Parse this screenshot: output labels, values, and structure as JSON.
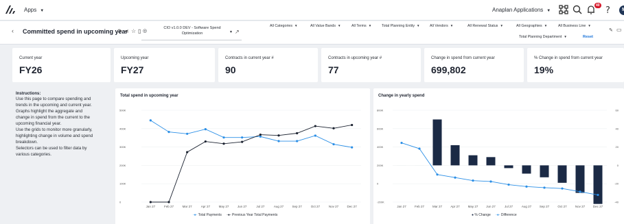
{
  "topbar": {
    "apps_label": "Apps",
    "app_name": "Anaplan Applications",
    "notification_count": "40",
    "avatar_initials": "M"
  },
  "header": {
    "title": "Committed spend in upcoming year",
    "version_label": "CIO v1.0.0 DEV - Software Spend Optimization",
    "filters": [
      "All Categories",
      "All Value Bands",
      "All Terms",
      "Total Planning Entity",
      "All Vendors",
      "All Renewal Status",
      "All Geographies",
      "All Business Line",
      "Total Planning Department"
    ],
    "reset_label": "Reset"
  },
  "kpis": [
    {
      "label": "Current year",
      "value": "FY26"
    },
    {
      "label": "Upcoming year",
      "value": "FY27"
    },
    {
      "label": "Contracts in current year #",
      "value": "90"
    },
    {
      "label": "Contracts in upcoming year #",
      "value": "77"
    },
    {
      "label": "Change in spend from current year",
      "value": "699,802"
    },
    {
      "label": "% Change in spend from current year",
      "value": "19%"
    }
  ],
  "instructions": {
    "title": "Instructions:",
    "lines": [
      "Use this page to compare spending and",
      "trends in the upcoming and current year.",
      "Graphs highlight the aggregate and",
      "change in spend from the current to the",
      "upcoming financial year.",
      "Use the grids to monitor more granularly,",
      "highlighting change in volume and spend",
      "breakdown.",
      "Selectors can be used to filter data by",
      "various categories."
    ]
  },
  "colors": {
    "blue": "#2b8fe6",
    "dark": "#1b2230",
    "navy": "#1b2a45",
    "accent_link": "#1a73d9",
    "badge_red": "#d6182a"
  },
  "chart_data": [
    {
      "type": "line",
      "title": "Total spend in upcoming year",
      "categories": [
        "Jan 27",
        "Feb 27",
        "Mar 27",
        "Apr 27",
        "May 27",
        "Jun 27",
        "Jul 27",
        "Aug 27",
        "Sep 27",
        "Oct 27",
        "Nov 27",
        "Dec 27"
      ],
      "yticks": [
        "0",
        "100K",
        "200K",
        "300K",
        "400K",
        "500K"
      ],
      "ylim": [
        0,
        500000
      ],
      "series": [
        {
          "name": "Total Payments",
          "color": "#2b8fe6",
          "values": [
            445000,
            382000,
            372000,
            397000,
            352000,
            352000,
            357000,
            332000,
            332000,
            362000,
            315000,
            298000
          ]
        },
        {
          "name": "Previous Year Total Payments",
          "color": "#1b2230",
          "values": [
            0,
            0,
            272000,
            330000,
            318000,
            328000,
            367000,
            363000,
            375000,
            414000,
            402000,
            420000
          ]
        }
      ],
      "legend": "bottom"
    },
    {
      "type": "bar+line",
      "title": "Change in yearly spend",
      "categories": [
        "Jan 27",
        "Feb 27",
        "Mar 27",
        "Apr 27",
        "May 27",
        "Jun 27",
        "Jul 27",
        "Aug 27",
        "Sep 27",
        "Oct 27",
        "Nov 27",
        "Dec 27"
      ],
      "left_yticks": [
        "-200K",
        "0",
        "200K",
        "400K",
        "600K",
        "800K"
      ],
      "left_ylim": [
        -200000,
        800000
      ],
      "right_yticks": [
        "-40",
        "-20",
        "0",
        "20",
        "40",
        "60"
      ],
      "right_ylim": [
        -40,
        60
      ],
      "series": [
        {
          "name": "% Change",
          "type": "bar",
          "axis": "right",
          "color": "#1b2a45",
          "values": [
            0,
            0,
            50,
            22,
            11,
            9,
            -3,
            -9,
            -13,
            -19,
            -30,
            -42
          ]
        },
        {
          "name": "Difference",
          "type": "line",
          "axis": "left",
          "color": "#2b8fe6",
          "values": [
            445000,
            382000,
            100000,
            67000,
            34000,
            24000,
            -10000,
            -31000,
            -43000,
            -52000,
            -87000,
            -122000
          ]
        }
      ],
      "legend": "bottom"
    }
  ]
}
